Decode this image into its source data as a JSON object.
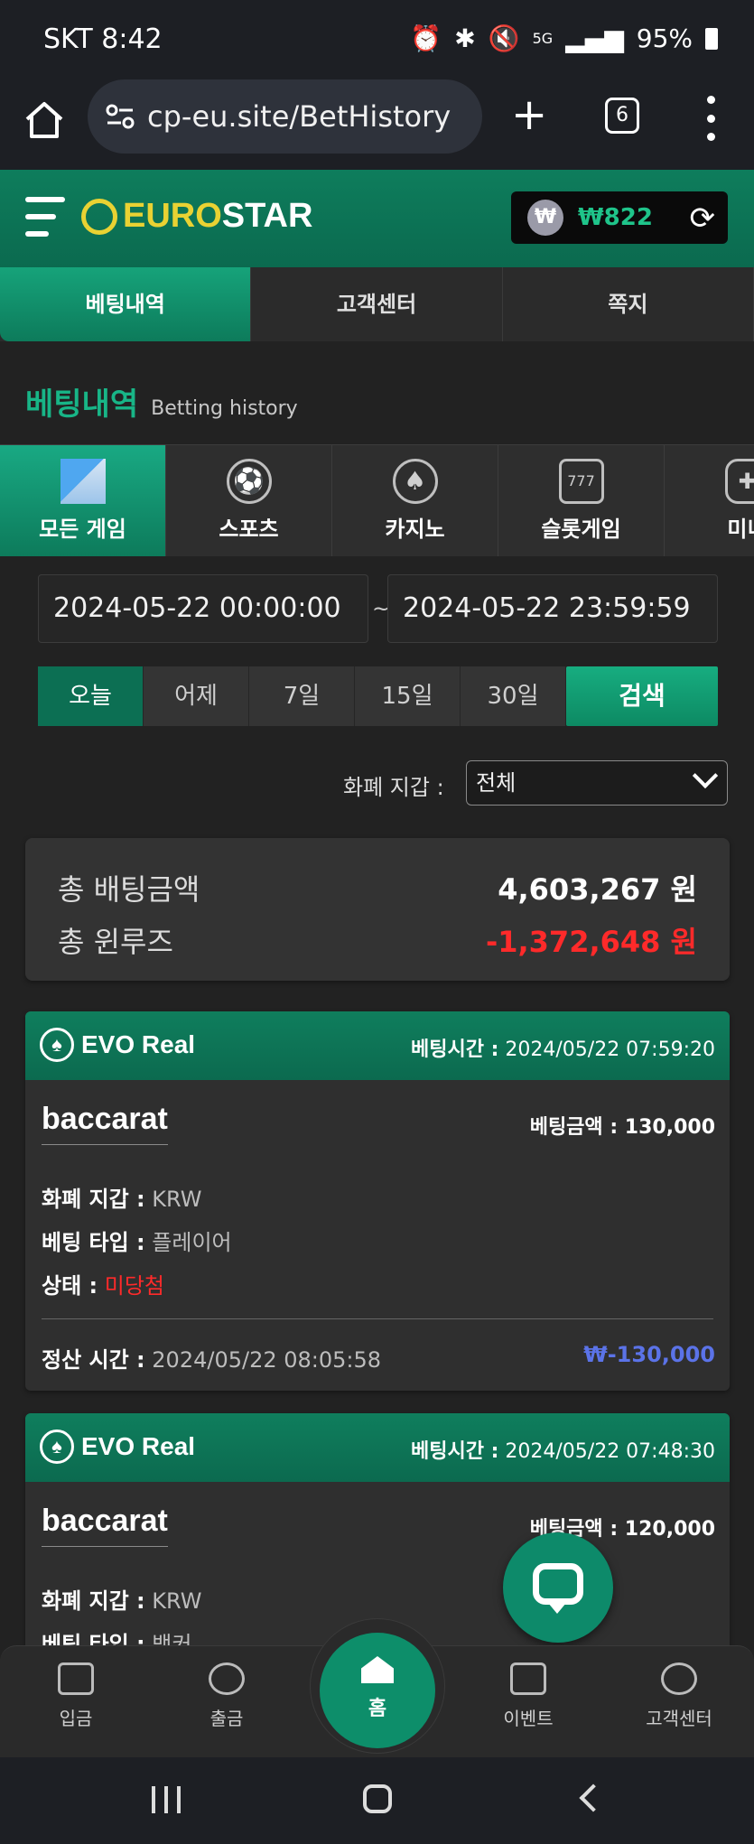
{
  "status_bar": {
    "carrier_time": "SKT 8:42",
    "battery": "95%",
    "network": "5G"
  },
  "browser": {
    "url": "cp-eu.site/BetHistory",
    "tab_count": "6"
  },
  "header": {
    "logo_part1": "EURO",
    "logo_part2": "STAR",
    "wallet_symbol": "₩",
    "wallet_amount": "₩822"
  },
  "top_tabs": [
    "베팅내역",
    "고객센터",
    "쪽지"
  ],
  "page": {
    "title_ko": "베팅내역",
    "title_en": "Betting history"
  },
  "categories": [
    {
      "label": "모든 게임",
      "icon": "grid-icon"
    },
    {
      "label": "스포츠",
      "icon": "soccer-ball-icon"
    },
    {
      "label": "카지노",
      "icon": "casino-chip-icon"
    },
    {
      "label": "슬롯게임",
      "icon": "slot-machine-icon"
    },
    {
      "label": "미니",
      "icon": "gamepad-icon"
    }
  ],
  "date_range": {
    "start": "2024-05-22 00:00:00",
    "separator": "~",
    "end": "2024-05-22 23:59:59"
  },
  "range_buttons": [
    "오늘",
    "어제",
    "7일",
    "15일",
    "30일"
  ],
  "search_label": "검색",
  "filter": {
    "label": "화폐 지갑 :",
    "value": "전체"
  },
  "summary": {
    "total_bet_label": "총 배팅금액",
    "total_bet_value": "4,603,267 원",
    "total_winloss_label": "총 윈루즈",
    "total_winloss_value": "-1,372,648 원"
  },
  "bets": [
    {
      "provider": "EVO Real",
      "time_label": "베팅시간 :",
      "time": "2024/05/22 07:59:20",
      "game": "baccarat",
      "amount_label": "베팅금액 :",
      "amount": "130,000",
      "currency_label": "화폐 지갑 :",
      "currency": "KRW",
      "type_label": "베팅 타입 :",
      "type": "플레이어",
      "status_label": "상태 :",
      "status": "미당첨",
      "settle_label": "정산 시간 :",
      "settle_time": "2024/05/22 08:05:58",
      "payout": "₩-130,000"
    },
    {
      "provider": "EVO Real",
      "time_label": "베팅시간 :",
      "time": "2024/05/22 07:48:30",
      "game": "baccarat",
      "amount_label": "베팅금액 :",
      "amount": "120,000",
      "currency_label": "화폐 지갑 :",
      "currency": "KRW",
      "type_label": "베팅 타입 :",
      "type": "뱅커"
    }
  ],
  "bottom_nav": [
    {
      "label": "입금",
      "icon": "deposit-icon"
    },
    {
      "label": "출금",
      "icon": "withdraw-icon"
    },
    {
      "label": "홈",
      "icon": "home-icon"
    },
    {
      "label": "이벤트",
      "icon": "megaphone-icon"
    },
    {
      "label": "고객센터",
      "icon": "support-24-icon"
    }
  ],
  "colors": {
    "accent": "#0e7d5c",
    "accent_light": "#18b587",
    "loss_red": "#ff2a2a",
    "payout_blue": "#5b73e8",
    "logo_yellow": "#e9d233"
  }
}
